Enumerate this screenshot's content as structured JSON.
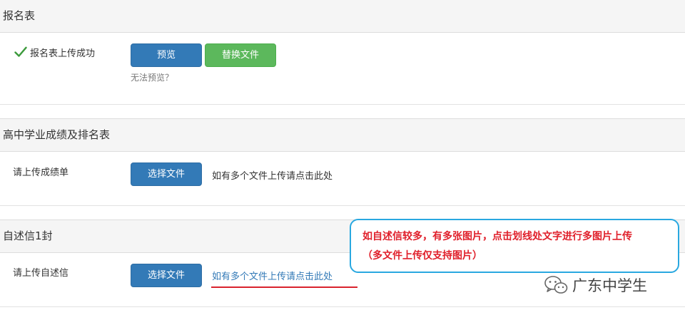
{
  "sections": [
    {
      "title": "报名表",
      "status_label": "报名表上传成功",
      "buttons": {
        "preview": "预览",
        "replace": "替换文件"
      },
      "help_link": "无法预览？"
    },
    {
      "title": "高中学业成绩及排名表",
      "upload_label": "请上传成绩单",
      "select_button": "选择文件",
      "multi_file_hint": "如有多个文件上传请点击此处"
    },
    {
      "title": "自述信1封",
      "upload_label": "请上传自述信",
      "select_button": "选择文件",
      "multi_file_link": "如有多个文件上传请点击此处"
    }
  ],
  "callout": {
    "line1": "如自述信较多，有多张图片，点击划线处文字进行多图片上传",
    "line2": "（多文件上传仅支持图片）"
  },
  "watermark": {
    "text": "广东中学生",
    "icon": "wechat-icon"
  },
  "colors": {
    "primary": "#337ab7",
    "success": "#5cb85c",
    "callout_border": "#29a8e0",
    "callout_text": "#e0202b",
    "underline": "#d9232d",
    "check": "#3c9a3c"
  }
}
